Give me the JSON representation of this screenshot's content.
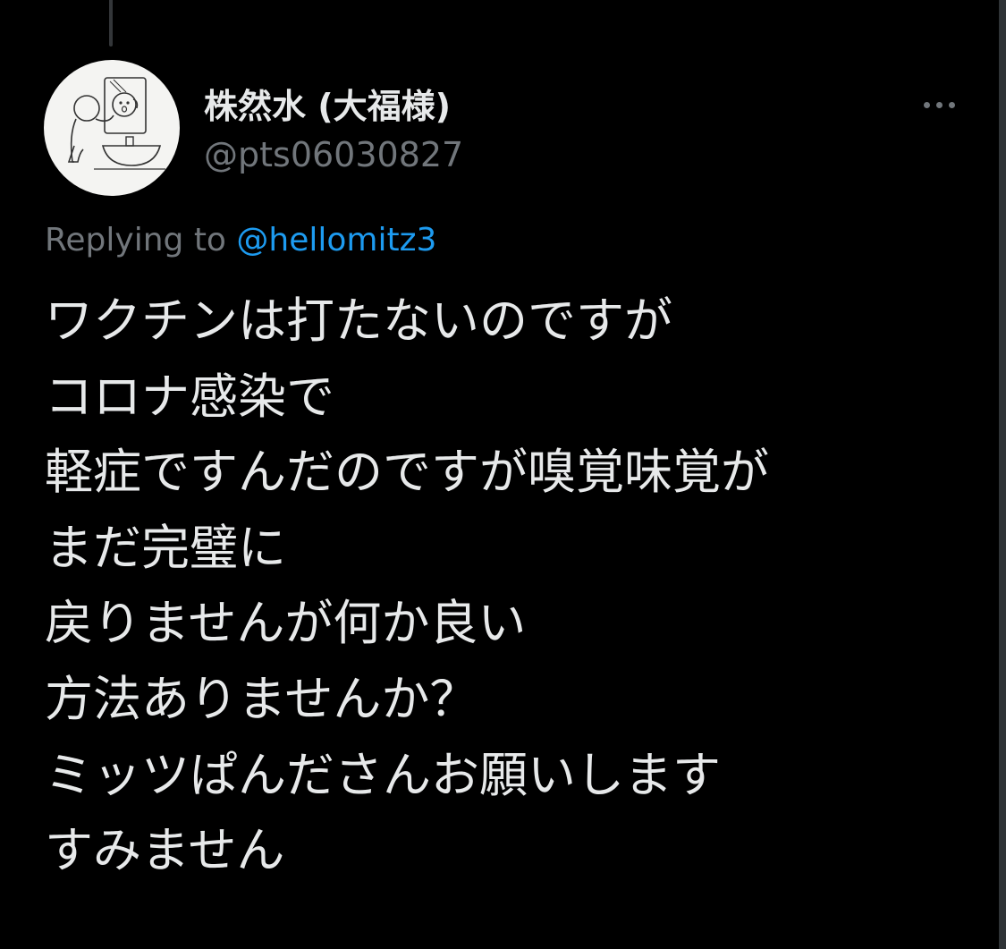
{
  "tweet": {
    "author": {
      "display_name": "株然水 (大福様)",
      "handle": "@pts06030827",
      "avatar_icon": "avatar-icon"
    },
    "more_icon": "more-horizontal-icon",
    "reply": {
      "prefix": "Replying to ",
      "mention": "@hellomitz3"
    },
    "lines": [
      "ワクチンは打たないのですが",
      "コロナ感染で",
      "軽症ですんだのですが嗅覚味覚が",
      "まだ完璧に",
      "戻りませんが何か良い",
      "方法ありませんか？",
      "ミッツぱんださんお願いします",
      "すみません"
    ]
  },
  "colors": {
    "background": "#000000",
    "text_primary": "#E7E9EA",
    "text_secondary": "#71767B",
    "accent": "#1D9BF0",
    "thread_line": "#333639"
  }
}
